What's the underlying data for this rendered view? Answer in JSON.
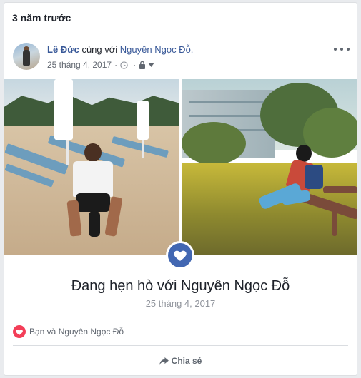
{
  "header": {
    "title": "3 năm trước"
  },
  "post": {
    "author": "Lê Đức",
    "with_text": "cùng với",
    "tagged": "Nguyên Ngọc Đỗ.",
    "date": "25 tháng 4, 2017",
    "separator": "·",
    "icons": [
      "clock-icon",
      "lock-icon",
      "caret-down-icon",
      "more-icon"
    ]
  },
  "event": {
    "title": "Đang hẹn hò với Nguyên Ngọc Đỗ",
    "date": "25 tháng 4, 2017",
    "badge_icon": "heart-icon"
  },
  "reactions": {
    "text": "Bạn và Nguyên Ngọc Đỗ",
    "icon": "love-reaction-icon"
  },
  "actions": {
    "share": "Chia sẻ",
    "share_icon": "share-arrow-icon"
  },
  "colors": {
    "link": "#385898",
    "badge": "#4267b2",
    "love": "#f33e58",
    "muted": "#90949c"
  }
}
